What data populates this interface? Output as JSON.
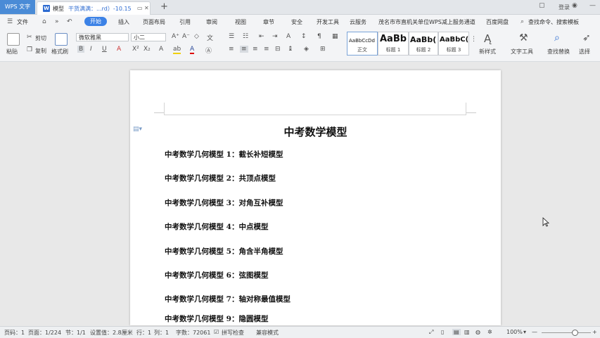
{
  "titlebar": {
    "app_label": "WPS 文字",
    "doc_name": "模型",
    "doc_status": "干货满满：...rd）-10.15",
    "new_tab": "+",
    "login_label": "登录"
  },
  "menu": {
    "file": "文件",
    "items": [
      "开始",
      "插入",
      "页面布局",
      "引用",
      "审阅",
      "视图",
      "章节",
      "安全",
      "开发工具",
      "云服务",
      "茂名市市直机关单位WPS减上服务通道",
      "百度网盘"
    ],
    "search_placeholder": "查找命令、搜索模板"
  },
  "ribbon": {
    "paste": "粘贴",
    "cut": "剪切",
    "copy": "复制",
    "format_painter": "格式刷",
    "font_name": "微软雅黑",
    "font_size": "小二",
    "styles": [
      {
        "sample": "AaBbCcDd",
        "label": "正文"
      },
      {
        "sample": "AaBb",
        "label": "标题 1"
      },
      {
        "sample": "AaBb(",
        "label": "标题 2"
      },
      {
        "sample": "AaBbC(",
        "label": "标题 3"
      }
    ],
    "new_style": "新样式",
    "text_tools": "文字工具",
    "find_replace": "查找替换",
    "select": "选择"
  },
  "document": {
    "title": "中考数学模型",
    "lines": [
      "中考数学几何模型 1：截长补短模型",
      "中考数学几何模型 2：共顶点模型",
      "中考数学几何模型 3：对角互补模型",
      "中考数学几何模型 4：中点模型",
      "中考数学几何模型 5：角含半角模型",
      "中考数学几何模型 6：弦图模型",
      "中考数学几何模型 7：轴对称最值模型",
      "中考数学几何模型 9：隐圆模型"
    ]
  },
  "statusbar": {
    "page_num": "页码：1",
    "pages": "页面：1/224",
    "section": "节：1/1",
    "setting": "设置值：2.8厘米",
    "row": "行：1",
    "col": "列：1",
    "words": "字数：72061",
    "spell": "拼写检查",
    "revision": "兼容模式",
    "zoom": "100%"
  },
  "colors": {
    "accent": "#3c82e6",
    "logo": "#4a8bd6"
  }
}
